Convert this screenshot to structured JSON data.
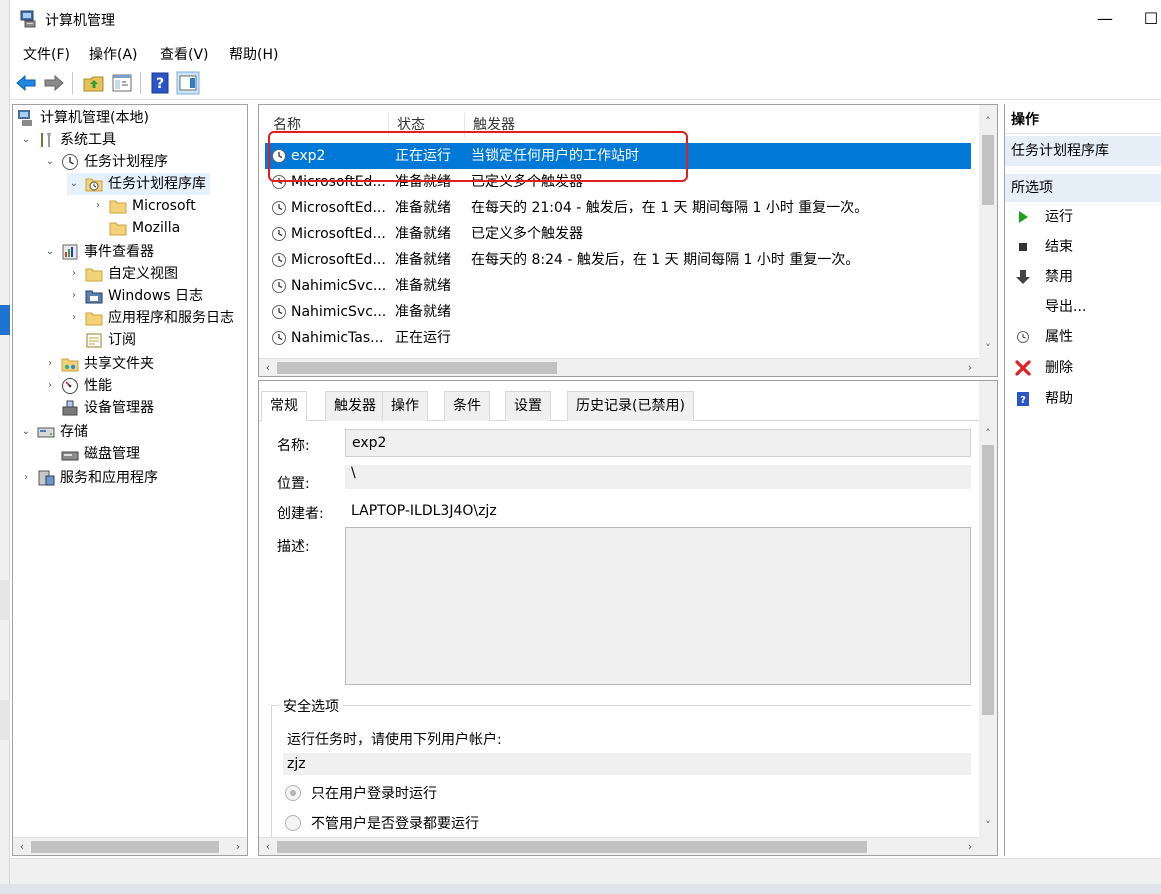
{
  "window": {
    "title": "计算机管理"
  },
  "menu": [
    "文件(F)",
    "操作(A)",
    "查看(V)",
    "帮助(H)"
  ],
  "tree": {
    "root": "计算机管理(本地)",
    "system_tools": "系统工具",
    "task_scheduler": "任务计划程序",
    "task_library": "任务计划程序库",
    "microsoft": "Microsoft",
    "mozilla": "Mozilla",
    "event_viewer": "事件查看器",
    "custom_views": "自定义视图",
    "windows_logs": "Windows 日志",
    "app_service_logs": "应用程序和服务日志",
    "subscriptions": "订阅",
    "shared_folders": "共享文件夹",
    "performance": "性能",
    "device_manager": "设备管理器",
    "storage": "存储",
    "disk_management": "磁盘管理",
    "services_apps": "服务和应用程序"
  },
  "task_list": {
    "headers": [
      "名称",
      "状态",
      "触发器"
    ],
    "rows": [
      {
        "name": "exp2",
        "status": "正在运行",
        "trigger": "当锁定任何用户的工作站时"
      },
      {
        "name": "MicrosoftEd...",
        "status": "准备就绪",
        "trigger": "已定义多个触发器"
      },
      {
        "name": "MicrosoftEd...",
        "status": "准备就绪",
        "trigger": "在每天的 21:04 - 触发后，在 1 天 期间每隔 1 小时 重复一次。"
      },
      {
        "name": "MicrosoftEd...",
        "status": "准备就绪",
        "trigger": "已定义多个触发器"
      },
      {
        "name": "MicrosoftEd...",
        "status": "准备就绪",
        "trigger": "在每天的 8:24 - 触发后，在 1 天 期间每隔 1 小时 重复一次。"
      },
      {
        "name": "NahimicSvc...",
        "status": "准备就绪",
        "trigger": ""
      },
      {
        "name": "NahimicSvc...",
        "status": "准备就绪",
        "trigger": ""
      },
      {
        "name": "NahimicTas...",
        "status": "正在运行",
        "trigger": ""
      }
    ]
  },
  "detail": {
    "tabs": [
      "常规",
      "触发器",
      "操作",
      "条件",
      "设置",
      "历史记录(已禁用)"
    ],
    "name_label": "名称:",
    "name_value": "exp2",
    "location_label": "位置:",
    "location_value": "\\",
    "author_label": "创建者:",
    "author_value": "LAPTOP-ILDL3J4O\\zjz",
    "desc_label": "描述:",
    "security_title": "安全选项",
    "run_as_label": "运行任务时，请使用下列用户帐户:",
    "run_as_user": "zjz",
    "option1": "只在用户登录时运行",
    "option2": "不管用户是否登录都要运行"
  },
  "actions": {
    "header": "操作",
    "section1": "任务计划程序库",
    "section2": "所选项",
    "items": [
      "运行",
      "结束",
      "禁用",
      "导出...",
      "属性",
      "删除",
      "帮助"
    ]
  },
  "colors": {
    "selection": "#0078d7",
    "highlight_box": "#e02020",
    "run_green": "#1fa01f",
    "delete_red": "#e02020",
    "help_blue": "#2a55c8"
  }
}
